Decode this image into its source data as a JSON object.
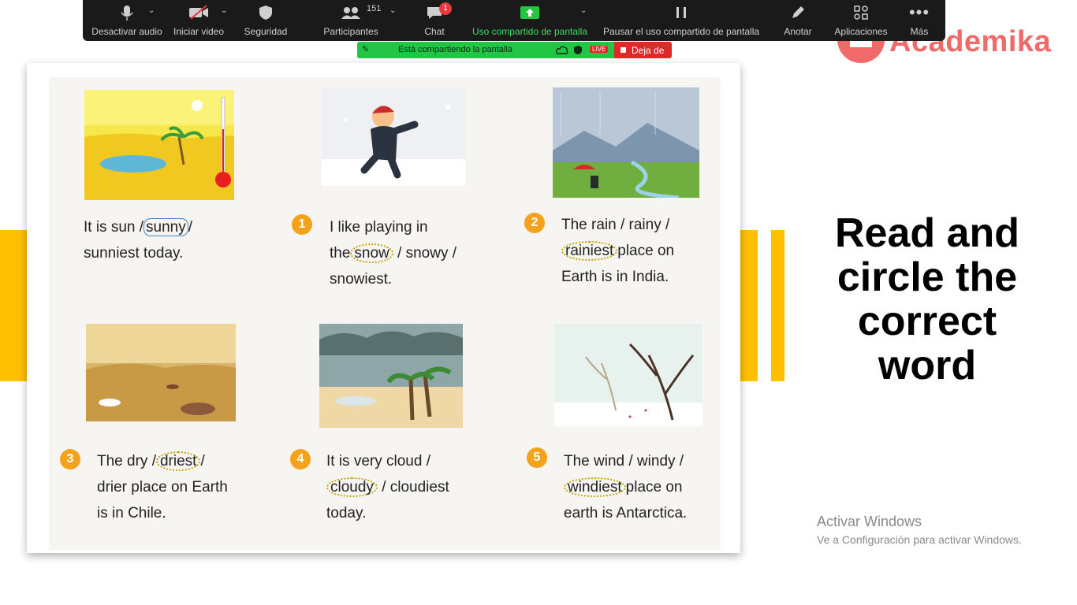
{
  "zoom_toolbar": {
    "mute_label": "Desactivar audio",
    "video_label": "Iniciar video",
    "security_label": "Seguridad",
    "participants_label": "Participantes",
    "participants_count": "151",
    "chat_label": "Chat",
    "chat_badge": "1",
    "share_label": "Uso compartido de pantalla",
    "pause_share_label": "Pausar el uso compartido de pantalla",
    "annotate_label": "Anotar",
    "apps_label": "Aplicaciones",
    "more_label": "Más"
  },
  "share_banner": {
    "text": "Está compartiendo la pantalla",
    "live": "LIVE",
    "stop_label": "Deja de"
  },
  "logo": {
    "text": "Academika"
  },
  "worksheet": {
    "example": {
      "lines": [
        "It is sun /",
        "sunny",
        "/",
        "sunniest today."
      ]
    },
    "items": [
      {
        "number": "1",
        "l1": "I like playing in",
        "l2a": "the",
        "l2b": "snow",
        "l2c": "/ snowy /",
        "l3": "snowiest."
      },
      {
        "number": "2",
        "l1": "The rain / rainy /",
        "l2b": "rainiest",
        "l2c": "place on",
        "l3": "Earth is in India."
      },
      {
        "number": "3",
        "l1a": "The dry /",
        "l1b": "driest",
        "l1c": "/",
        "l2": "drier place on Earth",
        "l3": "is in Chile."
      },
      {
        "number": "4",
        "l1": "It is very cloud /",
        "l2b": "cloudy",
        "l2c": "/ cloudiest",
        "l3": "today."
      },
      {
        "number": "5",
        "l1": "The wind / windy /",
        "l2b": "windiest",
        "l2c": "place on",
        "l3": "earth is Antarctica."
      }
    ]
  },
  "title": {
    "line1": "Read and",
    "line2": "circle the",
    "line3": "correct",
    "line4": "word"
  },
  "windows_watermark": {
    "line1": "Activar Windows",
    "line2": "Ve a Configuración para activar Windows."
  },
  "colors": {
    "accent_yellow": "#FFC000",
    "zoom_green": "#23c545",
    "stop_red": "#e02828",
    "logo_red": "#F06A6A"
  }
}
